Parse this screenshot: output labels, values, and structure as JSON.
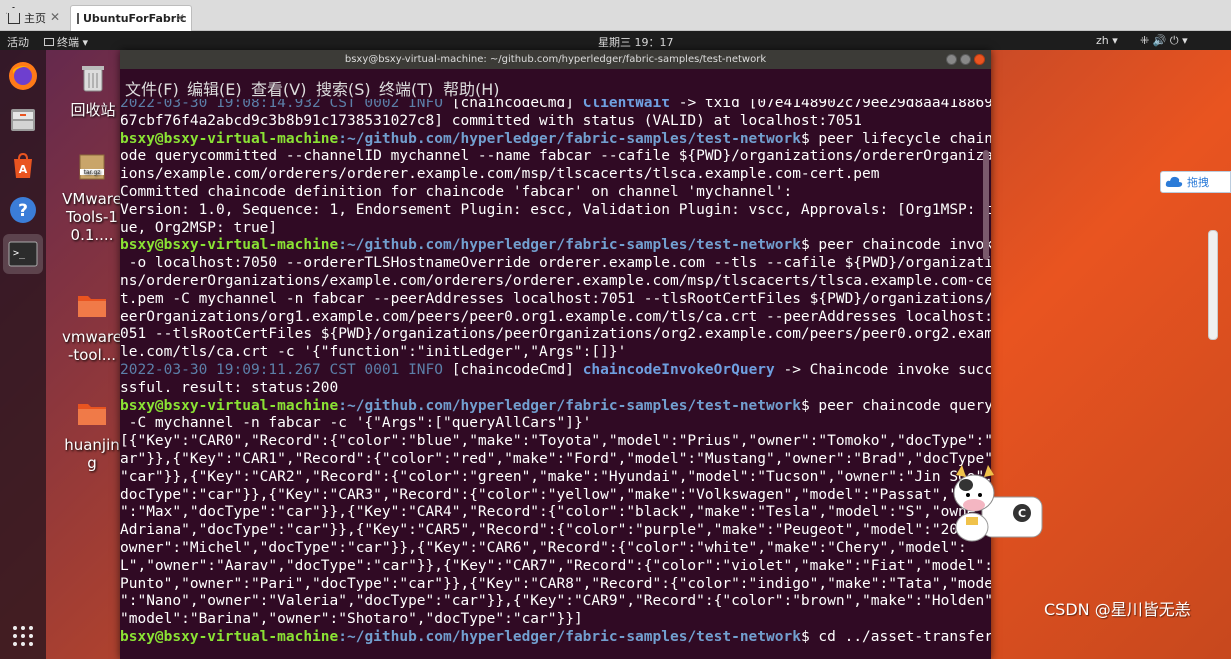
{
  "tabs": [
    {
      "label": "主页",
      "active": false
    },
    {
      "label": "UbuntuForFabric",
      "active": true
    }
  ],
  "topbar": {
    "activities": "活动",
    "app_menu": "终端 ▾",
    "clock": "星期三 19：17",
    "lang": "zh ▾",
    "status_icons": "⁜ 🔊 ⏻ ▾"
  },
  "desktop_icons": [
    {
      "label": "回收站",
      "icon": "trash-icon"
    },
    {
      "label": "VMwareTools-10.1....",
      "icon": "archive-icon"
    },
    {
      "label": "vmware-tool...",
      "icon": "folder-icon"
    },
    {
      "label": "huanjing",
      "icon": "folder-icon"
    }
  ],
  "dock": [
    "firefox-icon",
    "files-icon",
    "software-icon",
    "help-icon",
    "terminal-icon",
    "apps-grid-icon"
  ],
  "terminal": {
    "title": "bsxy@bsxy-virtual-machine: ~/github.com/hyperledger/fabric-samples/test-network",
    "menu": [
      "文件(F)",
      "编辑(E)",
      "查看(V)",
      "搜索(S)",
      "终端(T)",
      "帮助(H)"
    ],
    "prompt_user": "bsxy@bsxy-virtual-machine",
    "prompt_path": ":~/github.com/hyperledger/fabric-samples/test-network",
    "lines": [
      {
        "ts": "2022-03-30 19:08:14.932 CST 0002 INFO",
        "text": " [chaincodeCmd] ",
        "fn": "ClientWait",
        "rest": " -> txid [07e4148902c79ee29d8aa4188699"
      },
      {
        "text": "67cbf76f4a2abcd9c3b8b91c1738531027c8] committed with status (VALID) at localhost:7051"
      },
      {
        "prompt": true,
        "text": "$ peer lifecycle chainc"
      },
      {
        "text": "ode querycommitted --channelID mychannel --name fabcar --cafile ${PWD}/organizations/ordererOrganizat"
      },
      {
        "text": "ions/example.com/orderers/orderer.example.com/msp/tlscacerts/tlsca.example.com-cert.pem"
      },
      {
        "text": "Committed chaincode definition for chaincode 'fabcar' on channel 'mychannel':"
      },
      {
        "text": "Version: 1.0, Sequence: 1, Endorsement Plugin: escc, Validation Plugin: vscc, Approvals: [Org1MSP: tr"
      },
      {
        "text": "ue, Org2MSP: true]"
      },
      {
        "prompt": true,
        "text": "$ peer chaincode invoke"
      },
      {
        "text": " -o localhost:7050 --ordererTLSHostnameOverride orderer.example.com --tls --cafile ${PWD}/organizatio"
      },
      {
        "text": "ns/ordererOrganizations/example.com/orderers/orderer.example.com/msp/tlscacerts/tlsca.example.com-cer"
      },
      {
        "text": "t.pem -C mychannel -n fabcar --peerAddresses localhost:7051 --tlsRootCertFiles ${PWD}/organizations/p"
      },
      {
        "text": "eerOrganizations/org1.example.com/peers/peer0.org1.example.com/tls/ca.crt --peerAddresses localhost:9"
      },
      {
        "text": "051 --tlsRootCertFiles ${PWD}/organizations/peerOrganizations/org2.example.com/peers/peer0.org2.examp"
      },
      {
        "text": "le.com/tls/ca.crt -c '{\"function\":\"initLedger\",\"Args\":[]}'"
      },
      {
        "ts": "2022-03-30 19:09:11.267 CST 0001 INFO",
        "text": " [chaincodeCmd] ",
        "fn": "chaincodeInvokeOrQuery",
        "rest": " -> Chaincode invoke succe"
      },
      {
        "text": "ssful. result: status:200"
      },
      {
        "prompt": true,
        "text": "$ peer chaincode query"
      },
      {
        "text": " -C mychannel -n fabcar -c '{\"Args\":[\"queryAllCars\"]}'"
      },
      {
        "text": "[{\"Key\":\"CAR0\",\"Record\":{\"color\":\"blue\",\"make\":\"Toyota\",\"model\":\"Prius\",\"owner\":\"Tomoko\",\"docType\":\"c"
      },
      {
        "text": "ar\"}},{\"Key\":\"CAR1\",\"Record\":{\"color\":\"red\",\"make\":\"Ford\",\"model\":\"Mustang\",\"owner\":\"Brad\",\"docType\":"
      },
      {
        "text": "\"car\"}},{\"Key\":\"CAR2\",\"Record\":{\"color\":\"green\",\"make\":\"Hyundai\",\"model\":\"Tucson\",\"owner\":\"Jin Soo\",\""
      },
      {
        "text": "docType\":\"car\"}},{\"Key\":\"CAR3\",\"Record\":{\"color\":\"yellow\",\"make\":\"Volkswagen\",\"model\":\"Passat\",\"ow"
      },
      {
        "text": "\":\"Max\",\"docType\":\"car\"}},{\"Key\":\"CAR4\",\"Record\":{\"color\":\"black\",\"make\":\"Tesla\",\"model\":\"S\",\"owne"
      },
      {
        "text": "Adriana\",\"docType\":\"car\"}},{\"Key\":\"CAR5\",\"Record\":{\"color\":\"purple\",\"make\":\"Peugeot\",\"model\":\"20"
      },
      {
        "text": "owner\":\"Michel\",\"docType\":\"car\"}},{\"Key\":\"CAR6\",\"Record\":{\"color\":\"white\",\"make\":\"Chery\",\"model\":"
      },
      {
        "text": "L\",\"owner\":\"Aarav\",\"docType\":\"car\"}},{\"Key\":\"CAR7\",\"Record\":{\"color\":\"violet\",\"make\":\"Fiat\",\"model\":"
      },
      {
        "text": "Punto\",\"owner\":\"Pari\",\"docType\":\"car\"}},{\"Key\":\"CAR8\",\"Record\":{\"color\":\"indigo\",\"make\":\"Tata\",\"model"
      },
      {
        "text": "\":\"Nano\",\"owner\":\"Valeria\",\"docType\":\"car\"}},{\"Key\":\"CAR9\",\"Record\":{\"color\":\"brown\",\"make\":\"Holden\","
      },
      {
        "text": "\"model\":\"Barina\",\"owner\":\"Shotaro\",\"docType\":\"car\"}}]"
      },
      {
        "prompt": true,
        "text": "$ cd ../asset-transfer-"
      }
    ]
  },
  "side_widget": "拖拽",
  "watermark": "CSDN @星川皆无恙"
}
